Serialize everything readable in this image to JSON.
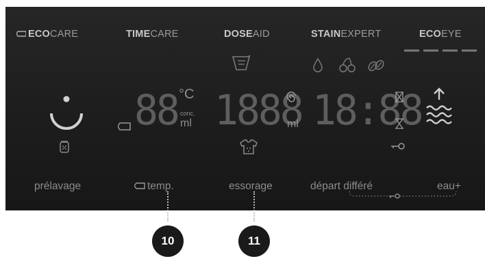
{
  "top_labels": [
    {
      "bold": "ECO",
      "rest": "CARE"
    },
    {
      "bold": "TIME",
      "rest": "CARE"
    },
    {
      "bold": "DOSE",
      "rest": "AID"
    },
    {
      "bold": "STAIN",
      "rest": "EXPERT"
    },
    {
      "bold": "ECO",
      "rest": "EYE"
    }
  ],
  "display": {
    "temp_digits": "88",
    "temp_unit": "°C",
    "conc_label": "conc.",
    "temp_ml_unit": "ml",
    "dose_digits": "1888",
    "dose_unit": "ml",
    "time_digits": "18:88"
  },
  "bottom_labels": {
    "prelavage": "prélavage",
    "temp": "temp.",
    "essorage": "essorage",
    "depart_differe": "départ différé",
    "eau_plus": "eau+"
  },
  "callouts": {
    "c10": "10",
    "c11": "11"
  },
  "colors": {
    "panel": "#1f1f1f",
    "segment_off": "#5e5e5e",
    "label": "#8c8c8c",
    "callout_bg": "#1a1a1a"
  }
}
